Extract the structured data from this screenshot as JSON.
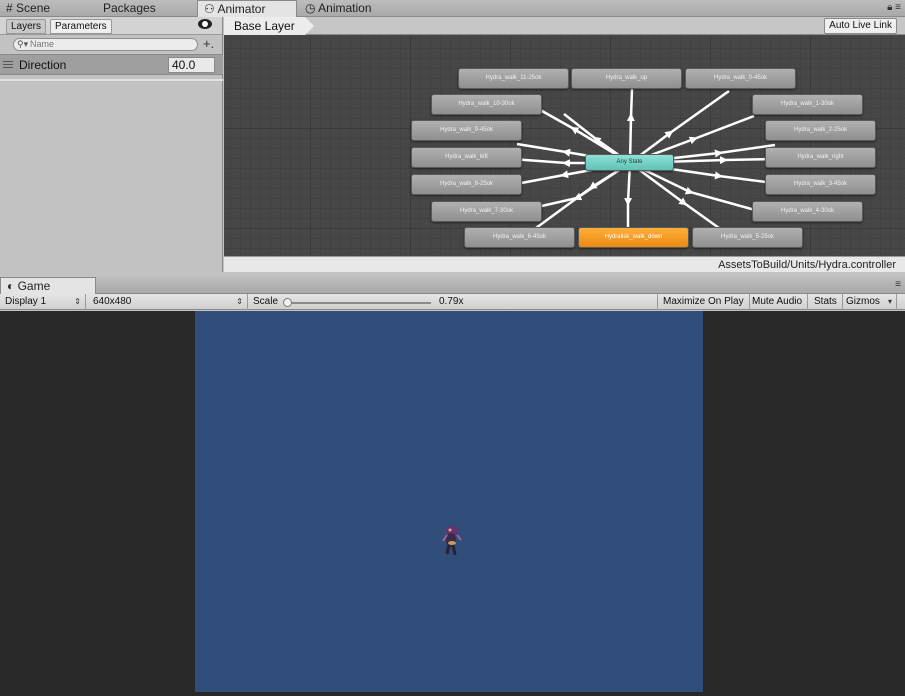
{
  "top_tabs": [
    {
      "label": "Scene",
      "icon": "grid-icon"
    },
    {
      "label": "Packages"
    },
    {
      "label": "Animator",
      "icon": "animator-icon"
    },
    {
      "label": "Animation",
      "icon": "clock-icon"
    }
  ],
  "parameters_panel": {
    "tabs": [
      "Layers",
      "Parameters"
    ],
    "active_tab": "Parameters",
    "search_placeholder": "Name",
    "param": {
      "name": "Direction",
      "value": "40.0"
    }
  },
  "animator": {
    "breadcrumb": "Base Layer",
    "live_link_button": "Auto Live Link",
    "controller_path": "AssetsToBuild/Units/Hydra.controller",
    "states": {
      "any": "Any State",
      "default": "Hydralisk_walk_down",
      "s11": "Hydra_walk_11-25ok",
      "up": "Hydra_walk_up",
      "s0": "Hydra_walk_0-45ok",
      "s10": "Hydra_walk_10-30ok",
      "s1": "Hydra_walk_1-30ok",
      "s9": "Hydra_walk_9-45ok",
      "s2": "Hydra_walk_2-25ok",
      "left": "Hydra_walk_left",
      "right": "Hydra_walk_right",
      "s8": "Hydra_walk_8-25ok",
      "s3": "Hydra_walk_3-45ok",
      "s7": "Hydra_walk_7-30ok",
      "s4": "Hydra_walk_4-30ok",
      "s6": "Hydra_walk_6-45ok",
      "s5": "Hydra_walk_5-25ok"
    },
    "colors": {
      "any_state": "#6fcfc2",
      "default_state": "#f0931e",
      "state": "#9e9e9e"
    }
  },
  "game": {
    "tab_label": "Game",
    "toolbar": {
      "display": "Display 1",
      "resolution": "640x480",
      "scale_label": "Scale",
      "scale_value": "0.79x",
      "scale_fraction": 0.0,
      "maximize": "Maximize On Play",
      "mute": "Mute Audio",
      "stats": "Stats",
      "gizmos": "Gizmos"
    },
    "background_color": "#314d79"
  }
}
